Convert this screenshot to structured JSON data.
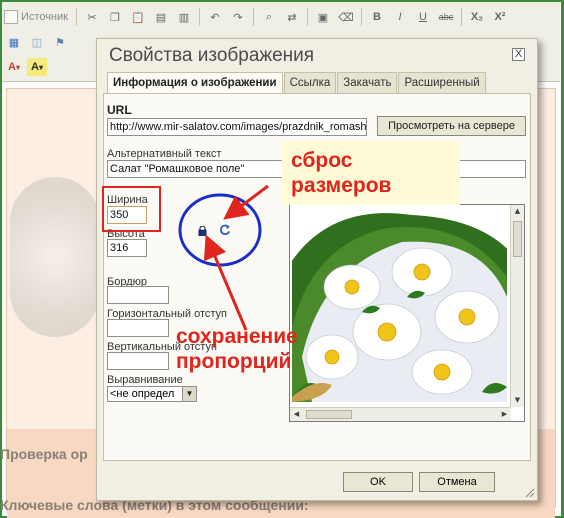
{
  "toolbar": {
    "source_label": "Источник",
    "bold": "B",
    "italic": "I",
    "underline": "U",
    "strike": "abc",
    "subscript": "X₂",
    "superscript": "X²",
    "font_color": "A",
    "bg_color": "A",
    "dropdown_arrow": "▾"
  },
  "page": {
    "line1": "Проверка ор",
    "line2": "Ключевые слова (метки) в этом сообщении:"
  },
  "dialog": {
    "title": "Свойства изображения",
    "close_glyph": "X",
    "tabs": [
      "Информация о изображении",
      "Ссылка",
      "Закачать",
      "Расширенный"
    ],
    "active_tab": 0,
    "url_label": "URL",
    "url_value": "http://www.mir-salatov.com/images/prazdnik_romashk",
    "browse_button": "Просмотреть на сервере",
    "alt_label": "Альтернативный текст",
    "alt_value": "Салат \"Ромашковое поле\"",
    "width_label": "Ширина",
    "width_value": "350",
    "height_label": "Высота",
    "height_value": "316",
    "border_label": "Бордюр",
    "border_value": "",
    "hspace_label": "Горизонтальный отступ",
    "hspace_value": "",
    "vspace_label": "Вертикальный отступ",
    "vspace_value": "",
    "align_label": "Выравнивание",
    "align_value": "<не определ",
    "ok_button": "OK",
    "cancel_button": "Отмена"
  },
  "annotations": {
    "reset_sizes": "сброс\nразмеров",
    "keep_proportions": "сохранение\nпропорций",
    "arrow_color": "#e0241e",
    "circle_color": "#1a2fc8",
    "box_color": "#e0241e"
  },
  "colors": {
    "frame": "#3c8a3c",
    "dialog_bg": "#f1efe4",
    "annotation_red": "#e0241e",
    "annotation_bg": "#fffbd6"
  }
}
